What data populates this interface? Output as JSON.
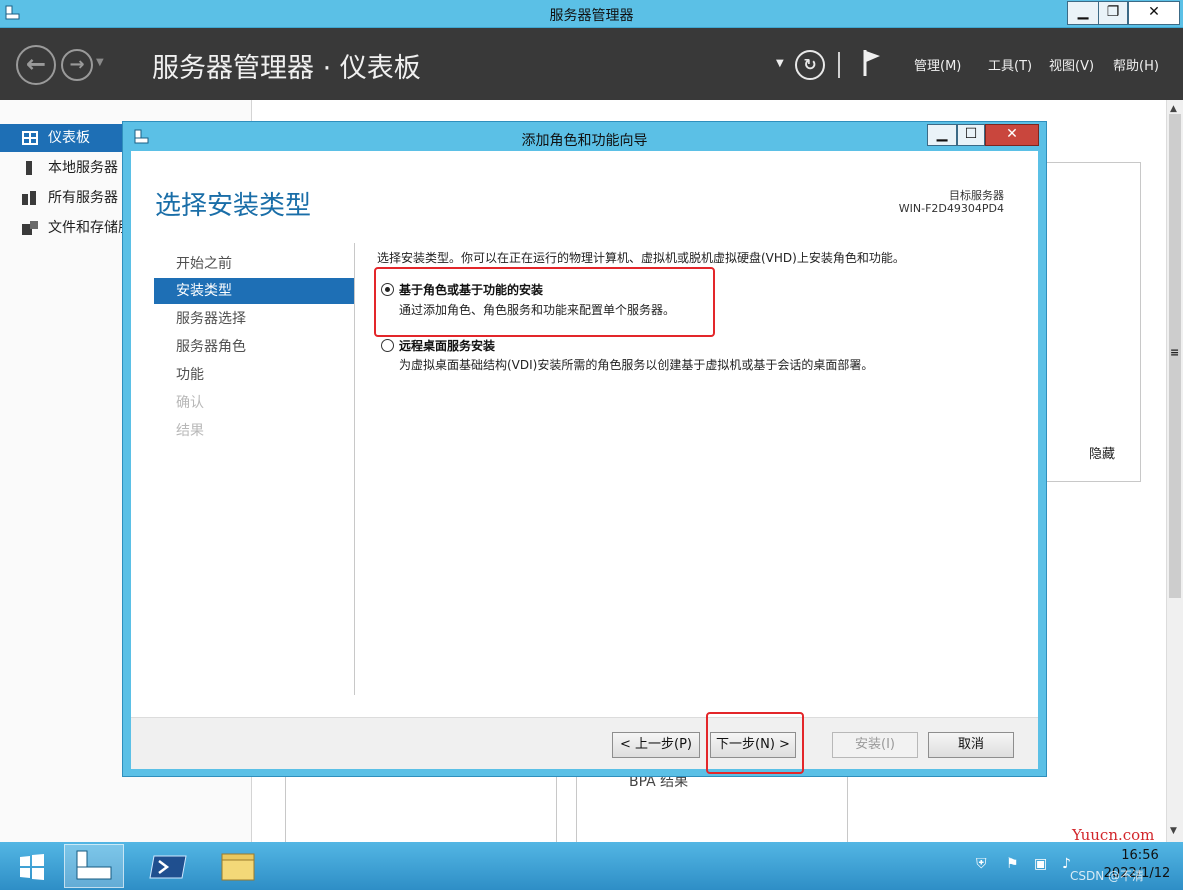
{
  "main_window": {
    "title": "服务器管理器",
    "minimize": "▁",
    "restore": "❐",
    "close": "✕"
  },
  "header": {
    "title": "服务器管理器 · 仪表板",
    "menus": [
      "管理(M)",
      "工具(T)",
      "视图(V)",
      "帮助(H)"
    ]
  },
  "left_nav": {
    "items": [
      "仪表板",
      "本地服务器",
      "所有服务器",
      "文件和存储服务"
    ]
  },
  "background": {
    "hide_label": "隐藏",
    "bpa_label": "BPA 结果"
  },
  "dialog": {
    "title": "添加角色和功能向导",
    "heading": "选择安装类型",
    "target_label": "目标服务器",
    "target_value": "WIN-F2D49304PD4",
    "steps": [
      "开始之前",
      "安装类型",
      "服务器选择",
      "服务器角色",
      "功能",
      "确认",
      "结果"
    ],
    "intro": "选择安装类型。你可以在正在运行的物理计算机、虚拟机或脱机虚拟硬盘(VHD)上安装角色和功能。",
    "option1_title": "基于角色或基于功能的安装",
    "option1_desc": "通过添加角色、角色服务和功能来配置单个服务器。",
    "option2_title": "远程桌面服务安装",
    "option2_desc": "为虚拟桌面基础结构(VDI)安装所需的角色服务以创建基于虚拟机或基于会话的桌面部署。",
    "buttons": {
      "prev": "< 上一步(P)",
      "next": "下一步(N) >",
      "install": "安装(I)",
      "cancel": "取消"
    }
  },
  "taskbar": {
    "time": "16:56",
    "date": "2022/1/12"
  },
  "watermark": {
    "site": "Yuucn.com",
    "csdn": "CSDN @不清"
  },
  "colors": {
    "accent": "#1e6fb5",
    "titlebar": "#5bc0e6",
    "header": "#393939",
    "highlight": "#e3262a"
  }
}
